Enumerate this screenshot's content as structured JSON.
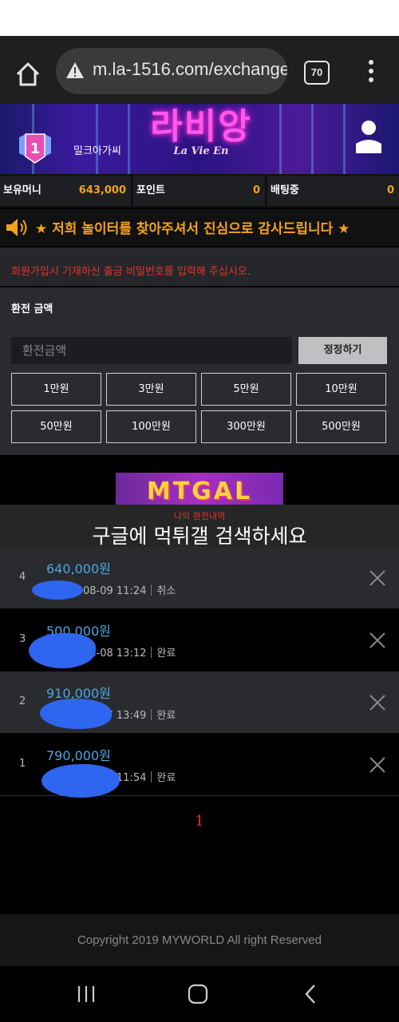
{
  "browser": {
    "url": "m.la-1516.com/exchange",
    "tab_count": "70"
  },
  "header": {
    "level": "1",
    "username": "밀크아가씨",
    "logo_main": "라비앙",
    "logo_sub": "La Vie En"
  },
  "balances": [
    {
      "label": "보유머니",
      "value": "643,000"
    },
    {
      "label": "포인트",
      "value": "0"
    },
    {
      "label": "배팅중",
      "value": "0"
    }
  ],
  "notice": "★ 저희 놀이터를 찾아주셔서 진심으로 감사드립니다 ★",
  "warning": "회원가입시 기재하신 출금 비밀번호를 입력해 주십시오.",
  "exchange": {
    "title": "환전 금액",
    "placeholder": "환전금액",
    "reset_label": "정정하기",
    "amounts": [
      "1만원",
      "3만원",
      "5만원",
      "10만원",
      "50만원",
      "100만원",
      "300만원",
      "500만원"
    ]
  },
  "banner": {
    "text": "MTGAL",
    "history_peek": "나의 환전내역",
    "overlay": "구글에 먹튀갤 검색하세요"
  },
  "history": [
    {
      "no": "4",
      "amount": "640,000원",
      "date": "08-09 11:24",
      "status": "취소"
    },
    {
      "no": "3",
      "amount": "500,000원",
      "date": "08-08 13:12",
      "status": "완료"
    },
    {
      "no": "2",
      "amount": "910,000원",
      "date": "08-07 13:49",
      "status": "완료"
    },
    {
      "no": "1",
      "amount": "790,000원",
      "date": "08-06 11:54",
      "status": "완료"
    }
  ],
  "pagination": {
    "current": "1"
  },
  "footer": {
    "copyright": "Copyright 2019 MYWORLD All right Reserved"
  },
  "colors": {
    "accent": "#f5a21b",
    "link": "#47a9e6",
    "alert": "#e2332e"
  }
}
